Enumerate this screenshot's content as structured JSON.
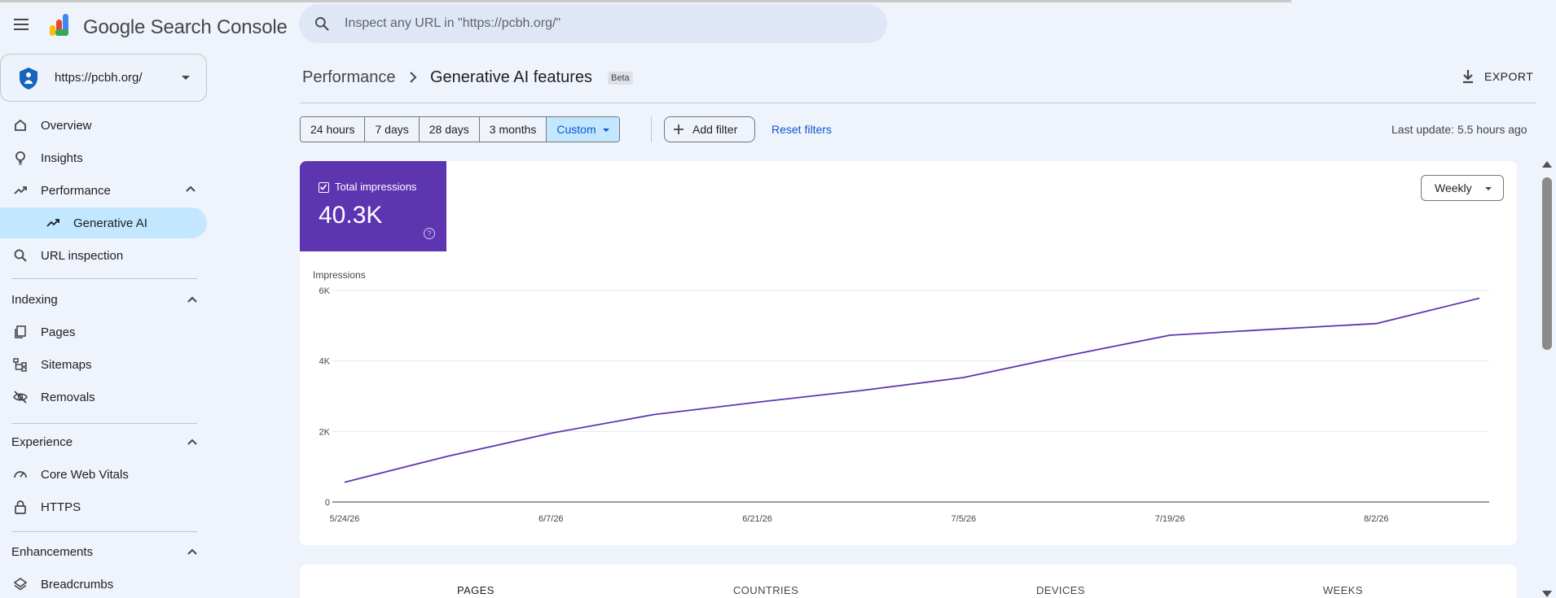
{
  "app": {
    "title": "Google Search Console"
  },
  "search": {
    "placeholder": "Inspect any URL in \"https://pcbh.org/\""
  },
  "property": {
    "label": "https://pcbh.org/"
  },
  "sidebar": {
    "items": [
      {
        "label": "Overview"
      },
      {
        "label": "Insights"
      },
      {
        "label": "Performance"
      },
      {
        "label": "Generative AI"
      },
      {
        "label": "URL inspection"
      }
    ],
    "indexing": {
      "heading": "Indexing",
      "items": [
        {
          "label": "Pages"
        },
        {
          "label": "Sitemaps"
        },
        {
          "label": "Removals"
        }
      ]
    },
    "experience": {
      "heading": "Experience",
      "items": [
        {
          "label": "Core Web Vitals"
        },
        {
          "label": "HTTPS"
        }
      ]
    },
    "enhancements": {
      "heading": "Enhancements",
      "items": [
        {
          "label": "Breadcrumbs"
        }
      ]
    }
  },
  "breadcrumb": {
    "root": "Performance",
    "current": "Generative AI features",
    "badge": "Beta"
  },
  "toolbar": {
    "export_label": "EXPORT"
  },
  "filters": {
    "ranges": [
      "24 hours",
      "7 days",
      "28 days",
      "3 months",
      "Custom"
    ],
    "selected": "Custom",
    "add_filter_label": "Add filter",
    "reset_label": "Reset filters",
    "last_update": "Last update: 5.5 hours ago"
  },
  "metric": {
    "label": "Total impressions",
    "value": "40.3K",
    "color": "#5e35b1",
    "checked": true
  },
  "granularity": {
    "label": "Weekly"
  },
  "chart_data": {
    "type": "line",
    "ylabel": "Impressions",
    "x": [
      "5/24/26",
      "5/31/26",
      "6/7/26",
      "6/14/26",
      "6/21/26",
      "6/28/26",
      "7/5/26",
      "7/12/26",
      "7/19/26",
      "7/26/26",
      "8/2/26",
      "8/9/26"
    ],
    "xticks": [
      "5/24/26",
      "6/7/26",
      "6/21/26",
      "7/5/26",
      "7/19/26",
      "8/2/26"
    ],
    "yticks": [
      "0",
      "2K",
      "4K",
      "6K"
    ],
    "ylim": [
      0,
      6000
    ],
    "series": [
      {
        "color": "#5e35b1",
        "values": [
          560,
          1300,
          1950,
          2480,
          2830,
          3160,
          3530,
          4150,
          4730,
          4900,
          5060,
          5780
        ]
      }
    ],
    "grid": true
  },
  "tabs": [
    "PAGES",
    "COUNTRIES",
    "DEVICES",
    "WEEKS"
  ]
}
